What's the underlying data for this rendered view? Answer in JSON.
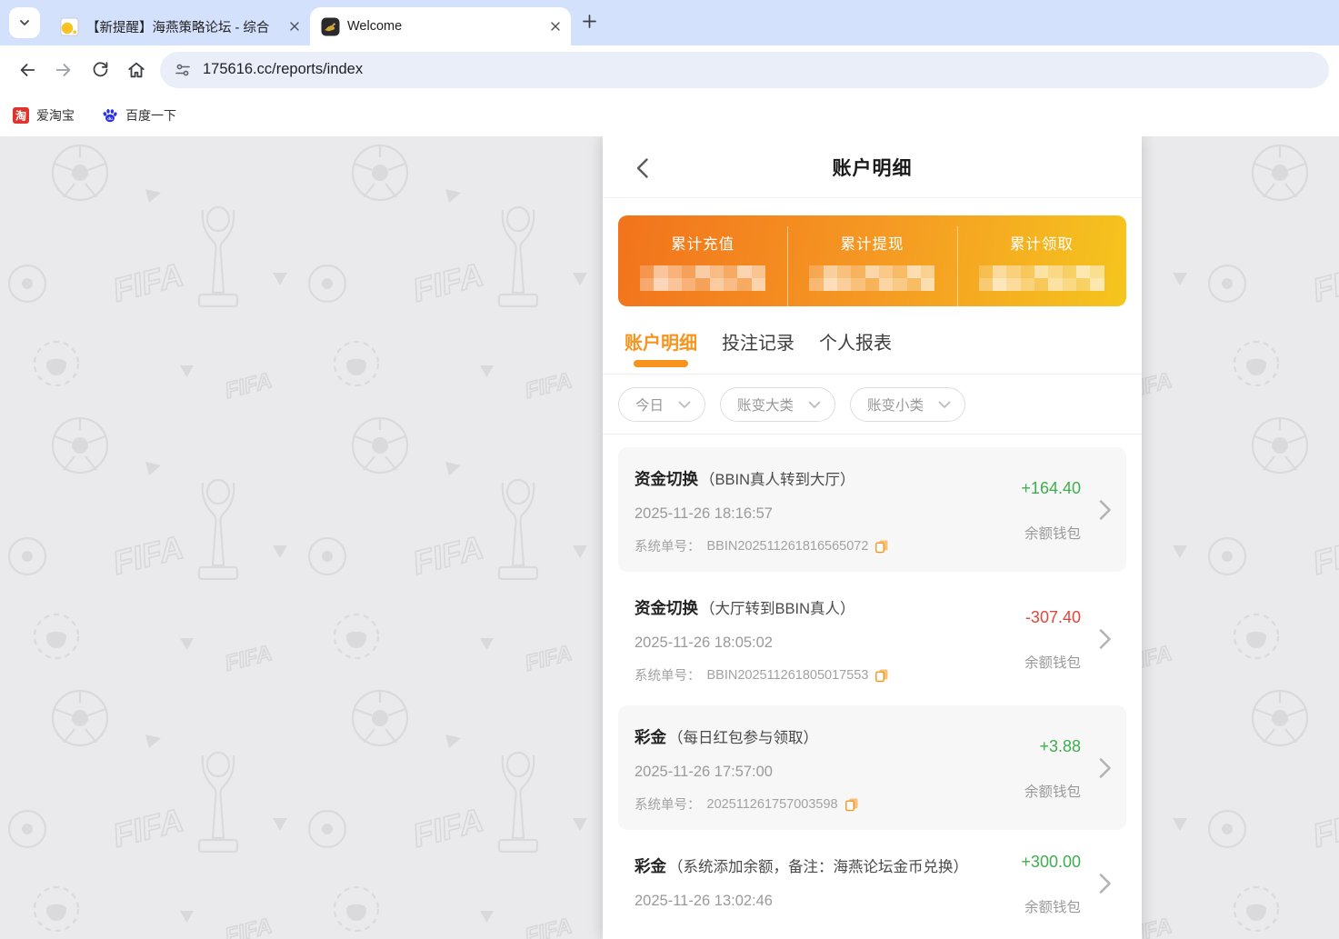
{
  "browser": {
    "tabs": [
      {
        "title": "【新提醒】海燕策略论坛 - 综合",
        "favicon": "forum-page-icon",
        "active": false
      },
      {
        "title": "Welcome",
        "favicon": "golden-animal-icon",
        "active": true
      }
    ],
    "url": "175616.cc/reports/index",
    "bookmarks": [
      {
        "label": "爱淘宝",
        "icon": "taobao-icon"
      },
      {
        "label": "百度一下",
        "icon": "baidu-paw-icon"
      }
    ]
  },
  "page": {
    "header_title": "账户明细",
    "summary_stats": [
      {
        "label": "累计充值",
        "value_censored": true
      },
      {
        "label": "累计提现",
        "value_censored": true
      },
      {
        "label": "累计领取",
        "value_censored": true
      }
    ],
    "tabs": [
      {
        "label": "账户明细",
        "active": true
      },
      {
        "label": "投注记录",
        "active": false
      },
      {
        "label": "个人报表",
        "active": false
      }
    ],
    "filters": [
      "今日",
      "账变大类",
      "账变小类"
    ],
    "order_label": "系统单号：",
    "items": [
      {
        "type": "资金切换",
        "note": "（BBIN真人转到大厅）",
        "datetime": "2025-11-26 18:16:57",
        "order_no": "BBIN202511261816565072",
        "amount": "+164.40",
        "direction": "in",
        "wallet": "余额钱包"
      },
      {
        "type": "资金切换",
        "note": "（大厅转到BBIN真人）",
        "datetime": "2025-11-26 18:05:02",
        "order_no": "BBIN202511261805017553",
        "amount": "-307.40",
        "direction": "out",
        "wallet": "余额钱包"
      },
      {
        "type": "彩金",
        "note": "（每日红包参与领取）",
        "datetime": "2025-11-26 17:57:00",
        "order_no": "202511261757003598",
        "amount": "+3.88",
        "direction": "in",
        "wallet": "余额钱包"
      },
      {
        "type": "彩金",
        "note": "（系统添加余额，备注：海燕论坛金币兑换）",
        "datetime": "2025-11-26 13:02:46",
        "order_no": "",
        "amount": "+300.00",
        "direction": "in",
        "wallet": "余额钱包"
      }
    ],
    "colors": {
      "accent_orange": "#f7941d",
      "positive_green": "#3fae4e",
      "negative_red": "#e5443c",
      "card_gradient_left": "#f2731c",
      "card_gradient_right": "#f5c51e",
      "tabstrip_blue": "#d3e1fc"
    }
  }
}
